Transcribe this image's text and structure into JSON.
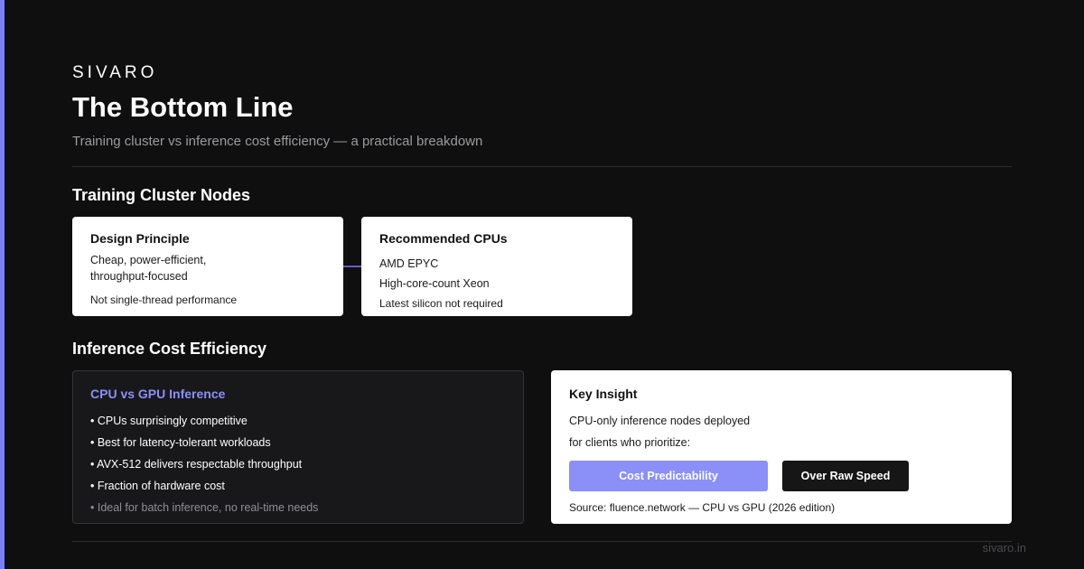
{
  "brand": "SIVARO",
  "title": "The Bottom Line",
  "subtitle": "Training cluster vs inference cost efficiency — a practical breakdown",
  "colors": {
    "accent": "#7b7ff5",
    "accent_light": "#8b8ff8",
    "background": "#0f0f0f",
    "card": "#ffffff",
    "card_dark": "#18181b"
  },
  "training": {
    "section_title": "Training Cluster Nodes",
    "design": {
      "heading": "Design Principle",
      "line1": "Cheap, power-efficient,",
      "line2": "throughput-focused",
      "note": "Not single-thread performance"
    },
    "cpus": {
      "heading": "Recommended CPUs",
      "item1": "AMD EPYC",
      "item2": "High-core-count Xeon",
      "note": "Latest silicon not required"
    },
    "connector_icon": "arrow-right-icon"
  },
  "inference": {
    "section_title": "Inference Cost Efficiency",
    "comparison": {
      "heading": "CPU vs GPU Inference",
      "bullets": [
        "• CPUs surprisingly competitive",
        "• Best for latency-tolerant workloads",
        "• AVX-512 delivers respectable throughput",
        "• Fraction of hardware cost",
        "• Ideal for batch inference, no real-time needs"
      ]
    },
    "insight": {
      "heading": "Key Insight",
      "line1": "CPU-only inference nodes deployed",
      "line2": "for clients who prioritize:",
      "primary_button": "Cost Predictability",
      "secondary_button": "Over Raw Speed",
      "source": "Source: fluence.network — CPU vs GPU (2026 edition)"
    }
  },
  "footer": {
    "site": "sivaro.in"
  }
}
